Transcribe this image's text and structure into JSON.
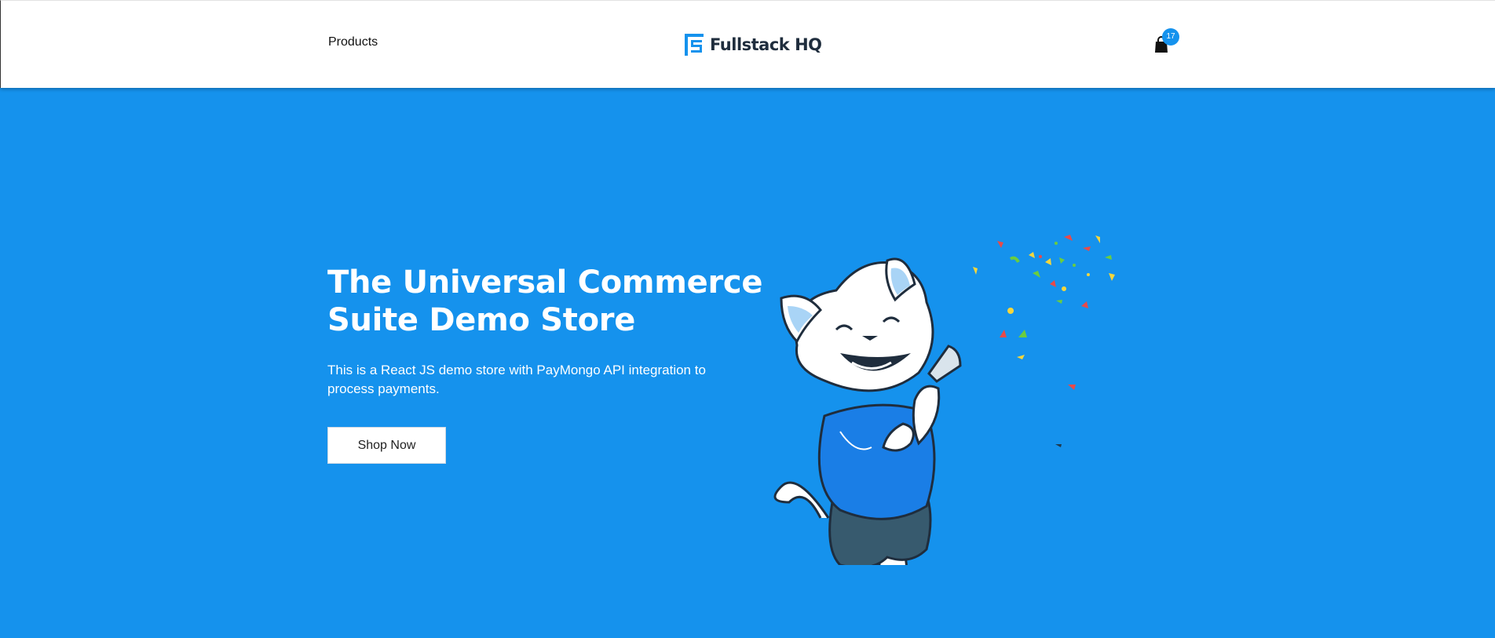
{
  "header": {
    "nav_products": "Products",
    "logo_text": "Fullstack HQ",
    "cart_count": "17"
  },
  "hero": {
    "title": "The Universal Commerce Suite Demo Store",
    "description": "This is a React JS demo store with PayMongo API integration to process payments.",
    "cta_label": "Shop Now"
  },
  "colors": {
    "brand_blue": "#1592ed",
    "header_bg": "#ffffff",
    "text_dark": "#1f2d3d"
  },
  "icons": {
    "logo": "fullstack-logo-icon",
    "cart": "shopping-bag-icon",
    "illustration": "party-cat-illustration"
  }
}
